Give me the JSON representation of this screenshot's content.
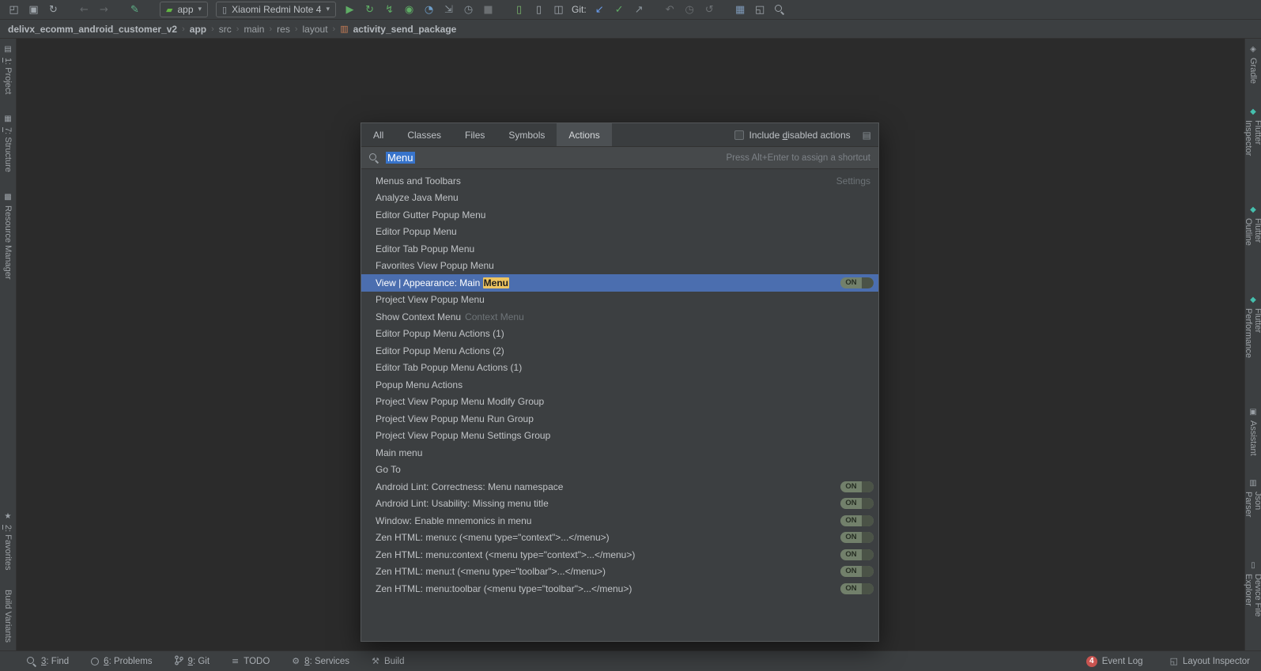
{
  "colors": {
    "panel": "#3c3f41",
    "editor": "#2b2b2b",
    "border": "#323232",
    "text": "#bdc1c5",
    "dim_text": "#9da2a6",
    "selection": "#4b6eaf",
    "match_bg": "#ecc35f",
    "toggle_bg": "#72806b",
    "toggle_knob": "#4b5347",
    "badge_red": "#c75450",
    "search_bg": "#46494b",
    "tab_active": "#4c5053",
    "text_selection": "#3874cb"
  },
  "toolbar": {
    "items": [
      {
        "type": "icon",
        "name": "open-icon",
        "glyph": "◰",
        "color": "#9fa6ac"
      },
      {
        "type": "icon",
        "name": "save-icon",
        "glyph": "▣",
        "color": "#9fa6ac"
      },
      {
        "type": "icon",
        "name": "sync-icon",
        "glyph": "↻",
        "color": "#9fa6ac"
      },
      {
        "type": "gap"
      },
      {
        "type": "icon",
        "name": "back-icon",
        "glyph": "←",
        "color": "#64686b"
      },
      {
        "type": "icon",
        "name": "forward-icon",
        "glyph": "→",
        "color": "#64686b"
      },
      {
        "type": "gap"
      },
      {
        "type": "icon",
        "name": "build-icon",
        "glyph": "✎",
        "color": "#5fb389"
      },
      {
        "type": "gap"
      },
      {
        "type": "chip",
        "name": "run-config-select",
        "icon_name": "app-module-icon",
        "icon_glyph": "▰",
        "icon_color": "#62b543",
        "label": "app"
      },
      {
        "type": "chip",
        "name": "device-select",
        "icon_name": "device-icon",
        "icon_glyph": "▯",
        "icon_color": "#9fa6ac",
        "label": "Xiaomi Redmi Note 4"
      },
      {
        "type": "icon",
        "name": "run-icon",
        "glyph": "▶",
        "color": "#5fad65"
      },
      {
        "type": "icon",
        "name": "apply-changes-icon",
        "glyph": "↻",
        "color": "#5fad65"
      },
      {
        "type": "icon",
        "name": "apply-code-changes-icon",
        "glyph": "↯",
        "color": "#5fad65"
      },
      {
        "type": "icon",
        "name": "debug-icon",
        "glyph": "◉",
        "color": "#5fad65"
      },
      {
        "type": "icon",
        "name": "profile-icon",
        "glyph": "◔",
        "color": "#6d9dc8"
      },
      {
        "type": "icon",
        "name": "attach-debugger-icon",
        "glyph": "⇲",
        "color": "#8a949b"
      },
      {
        "type": "icon",
        "name": "profiler-icon",
        "glyph": "◷",
        "color": "#8a949b"
      },
      {
        "type": "icon",
        "name": "stop-icon",
        "glyph": "■",
        "color": "#6b6f72"
      },
      {
        "type": "gap"
      },
      {
        "type": "icon",
        "name": "device-manager-icon",
        "glyph": "▯",
        "color": "#77b36a"
      },
      {
        "type": "icon",
        "name": "avd-manager-icon",
        "glyph": "▯",
        "color": "#9fa6ac"
      },
      {
        "type": "icon",
        "name": "pair-devices-icon",
        "glyph": "◫",
        "color": "#9fa6ac"
      },
      {
        "type": "label",
        "name": "git-label",
        "text": "Git:"
      },
      {
        "type": "icon",
        "name": "git-update-icon",
        "glyph": "↙",
        "color": "#6a9ced"
      },
      {
        "type": "icon",
        "name": "git-commit-icon",
        "glyph": "✓",
        "color": "#5fad65"
      },
      {
        "type": "icon",
        "name": "git-push-icon",
        "glyph": "↗",
        "color": "#8a949b"
      },
      {
        "type": "gap"
      },
      {
        "type": "icon",
        "name": "shelve-icon",
        "glyph": "↶",
        "color": "#6b6f72"
      },
      {
        "type": "icon",
        "name": "history-icon",
        "glyph": "◷",
        "color": "#6b6f72"
      },
      {
        "type": "icon",
        "name": "undo-icon",
        "glyph": "↺",
        "color": "#6b6f72"
      },
      {
        "type": "gap"
      },
      {
        "type": "icon",
        "name": "project-structure-icon",
        "glyph": "▦",
        "color": "#7e99b8"
      },
      {
        "type": "icon",
        "name": "window-layout-icon",
        "glyph": "◱",
        "color": "#9fa6ac"
      },
      {
        "type": "mag",
        "name": "search-everywhere-icon"
      }
    ]
  },
  "breadcrumb": {
    "file_icon_glyph": "▥",
    "items": [
      {
        "label": "delivx_ecomm_android_customer_v2",
        "bold": true
      },
      {
        "label": "app",
        "bold": true
      },
      {
        "label": "src",
        "bold": false
      },
      {
        "label": "main",
        "bold": false
      },
      {
        "label": "res",
        "bold": false
      },
      {
        "label": "layout",
        "bold": false
      },
      {
        "label": "activity_send_package",
        "bold": true
      }
    ]
  },
  "left_stripe": {
    "top": [
      {
        "u": "1",
        "rest": ": Project",
        "icon": "▤",
        "icon_color": "#9aa0a6"
      },
      {
        "u": "7",
        "rest": ": Structure",
        "icon": "▦",
        "icon_color": "#9aa0a6"
      },
      {
        "u": "",
        "rest": "Resource Manager",
        "icon": "▩",
        "icon_color": "#9aa0a6"
      }
    ],
    "bottom": [
      {
        "u": "2",
        "rest": ": Favorites",
        "icon": "★",
        "icon_color": "#9aa0a6"
      },
      {
        "u": "",
        "rest": "Build Variants",
        "icon": "",
        "icon_color": ""
      }
    ]
  },
  "right_stripe": [
    {
      "u": "",
      "rest": "Gradle",
      "icon": "◈",
      "icon_color": "#9aa0a6"
    },
    {
      "u": "",
      "rest": "Flutter Inspector",
      "icon": "◆",
      "icon_color": "#45c0ae"
    },
    {
      "u": "",
      "rest": "Flutter Outline",
      "icon": "◆",
      "icon_color": "#45c0ae"
    },
    {
      "u": "",
      "rest": "Flutter Performance",
      "icon": "◆",
      "icon_color": "#45c0ae"
    },
    {
      "u": "",
      "rest": "Assistant",
      "icon": "▣",
      "icon_color": "#9aa0a6"
    },
    {
      "u": "",
      "rest": "Json Parser",
      "icon": "▥",
      "icon_color": "#9aa0a6"
    },
    {
      "u": "",
      "rest": "Device File Explorer",
      "icon": "▯",
      "icon_color": "#9aa0a6"
    }
  ],
  "popup": {
    "tabs": [
      "All",
      "Classes",
      "Files",
      "Symbols",
      "Actions"
    ],
    "active_tab": "Actions",
    "include_disabled": {
      "pre": "Include ",
      "key": "d",
      "post": "isabled actions"
    },
    "filter_icon_glyph": "▤",
    "search_value": "Menu",
    "search_hint": "Press Alt+Enter to assign a shortcut",
    "results": [
      {
        "prefix": "Menus and Toolbars",
        "right_text": "Settings"
      },
      {
        "prefix": "Analyze Java Menu"
      },
      {
        "prefix": "Editor Gutter Popup Menu"
      },
      {
        "prefix": "Editor Popup Menu"
      },
      {
        "prefix": "Editor Tab Popup Menu"
      },
      {
        "prefix": "Favorites View Popup Menu"
      },
      {
        "prefix": "View | Appearance: Main ",
        "match": "Menu",
        "selected": true,
        "toggle": "ON"
      },
      {
        "prefix": "Project View Popup Menu"
      },
      {
        "prefix": "Show Context Menu",
        "gray_suffix": "Context Menu"
      },
      {
        "prefix": "Editor Popup Menu Actions (1)"
      },
      {
        "prefix": "Editor Popup Menu Actions (2)"
      },
      {
        "prefix": "Editor Tab Popup Menu Actions (1)"
      },
      {
        "prefix": "Popup Menu Actions"
      },
      {
        "prefix": "Project View Popup Menu Modify Group"
      },
      {
        "prefix": "Project View Popup Menu Run Group"
      },
      {
        "prefix": "Project View Popup Menu Settings Group"
      },
      {
        "prefix": "Main menu"
      },
      {
        "prefix": "Go To"
      },
      {
        "prefix": "Android Lint: Correctness: Menu namespace",
        "toggle": "ON"
      },
      {
        "prefix": "Android Lint: Usability: Missing menu title",
        "toggle": "ON"
      },
      {
        "prefix": "Window: Enable mnemonics in menu",
        "toggle": "ON"
      },
      {
        "prefix": "Zen HTML: menu:c (<menu type=\"context\">...</menu>)",
        "toggle": "ON"
      },
      {
        "prefix": "Zen HTML: menu:context (<menu type=\"context\">...</menu>)",
        "toggle": "ON"
      },
      {
        "prefix": "Zen HTML: menu:t (<menu type=\"toolbar\">...</menu>)",
        "toggle": "ON"
      },
      {
        "prefix": "Zen HTML: menu:toolbar (<menu type=\"toolbar\">...</menu>)",
        "toggle": "ON"
      }
    ]
  },
  "status_bar": {
    "left": [
      {
        "icon_type": "mag",
        "u": "3",
        "rest": ": Find",
        "name": "find-button"
      },
      {
        "icon_type": "ring",
        "u": "6",
        "rest": ": Problems",
        "name": "problems-button"
      },
      {
        "icon_type": "branch",
        "u": "9",
        "rest": ": Git",
        "name": "git-button"
      },
      {
        "icon_type": "glyph",
        "icon": "≡",
        "u": "",
        "rest": "TODO",
        "name": "todo-button"
      },
      {
        "icon_type": "glyph",
        "icon": "⚙",
        "u": "8",
        "rest": ": Services",
        "name": "services-button"
      },
      {
        "icon_type": "glyph",
        "icon": "⚒",
        "u": "",
        "rest": "Build",
        "name": "build-button"
      }
    ],
    "event_log": {
      "badge": "4",
      "label": "Event Log"
    },
    "layout_inspector_icon": "◱",
    "layout_inspector": "Layout Inspector"
  }
}
